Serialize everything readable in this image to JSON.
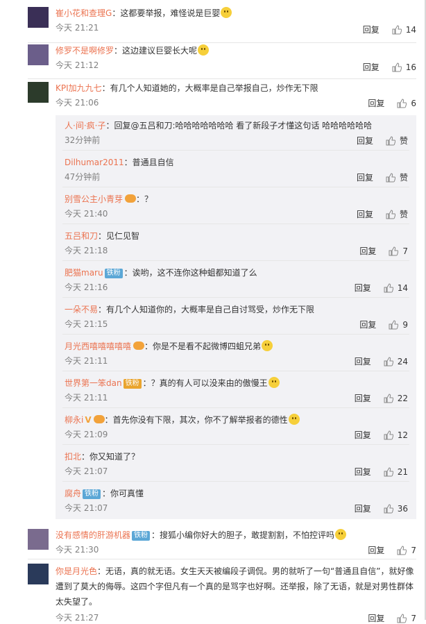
{
  "labels": {
    "reply": "回复",
    "like_word": "赞"
  },
  "comments": [
    {
      "user": "崔小花和查理G",
      "text": "：这都要举报，难怪说是巨婴",
      "emoji": "emoji",
      "time": "今天 21:21",
      "likes": "14",
      "avatar_color": "#3a2f56"
    },
    {
      "user": "修罗不是啊修罗",
      "text": "：这边建议巨婴长大呢",
      "emoji": "emoji",
      "time": "今天 21:12",
      "likes": "16",
      "avatar_color": "#6b5e8a"
    },
    {
      "user": "KPI加九九七",
      "text": "：有几个人知道她的，大概率是自己举报自己，炒作无下限",
      "time": "今天 21:06",
      "likes": "6",
      "avatar_color": "#2c3b2b"
    },
    {
      "user": "没有感情的肝游机器",
      "badge": "铁粉",
      "text": "：搜狐小编你好大的胆子，敢提割割，不怕控评吗",
      "emoji": "emoji",
      "time": "今天 21:30",
      "likes": "7",
      "avatar_color": "#7a6b8e"
    },
    {
      "user": "你是月光色",
      "text_lines": [
        "：无语，真的就无语。女生天天被编段子调侃。男的就听了一句“普通且自信”，就好像",
        "遭到了莫大的侮辱。这四个字但凡有一个真的是骂字也好啊。还举报，除了无语，就是对男性群体",
        "太失望了。"
      ],
      "time": "今天 21:27",
      "likes": "7",
      "avatar_color": "#2a3a5a"
    }
  ],
  "replies": [
    {
      "user": "人·间·疯·子",
      "text": "：回复@五吕和刀:哈哈哈哈哈哈哈 看了新段子才懂这句话 哈哈哈哈哈哈",
      "time": "32分钟前",
      "likes": "赞"
    },
    {
      "user": "Dilhumar2011",
      "text": "：普通且自信",
      "time": "47分钟前",
      "likes": "赞"
    },
    {
      "user": "别雪公主小青芽",
      "vip": true,
      "text": "：？",
      "time": "今天 21:40",
      "likes": "赞"
    },
    {
      "user": "五吕和刀",
      "text": "：见仁见智",
      "time": "今天 21:18",
      "likes": "7"
    },
    {
      "user": "肥猫maru",
      "badge": "铁粉",
      "text": "：诶哟，这不连你这种蛆都知道了么",
      "time": "今天 21:16",
      "likes": "14"
    },
    {
      "user": "一朵不易",
      "text": "：有几个人知道你的，大概率是自己自讨骂受，炒作无下限",
      "time": "今天 21:15",
      "likes": "9"
    },
    {
      "user": "月光西嘻嘻嘻嘻嘻",
      "vip": true,
      "text": "：你是不是看不起微博四蛆兄弟",
      "emoji": "emoji",
      "time": "今天 21:11",
      "likes": "24"
    },
    {
      "user": "世界第一笨dan",
      "badge_gold": "铁粉",
      "text": "：？真的有人可以没来由的傲慢王",
      "emoji": "emoji",
      "time": "今天 21:11",
      "likes": "22"
    },
    {
      "user": "柳永i",
      "vip_v": "V",
      "vip": true,
      "text": "：首先你没有下限，其次，你不了解举报者的德性",
      "emoji": "emoji",
      "time": "今天 21:09",
      "likes": "12"
    },
    {
      "user": "扣北",
      "text": "：你又知道了？",
      "time": "今天 21:07",
      "likes": "21"
    },
    {
      "user": "腐舟",
      "badge": "铁粉",
      "text": "：你可真懂",
      "time": "今天 21:07",
      "likes": "36"
    }
  ]
}
